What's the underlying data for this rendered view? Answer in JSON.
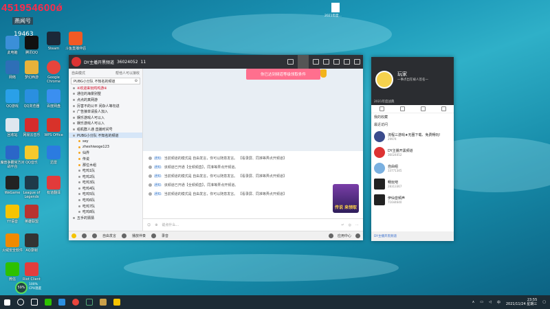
{
  "overlay": {
    "number": "451954600ǿ",
    "sub": "燕闻号",
    "num2": "19463"
  },
  "desktop": {
    "col1": [
      "此电脑",
      "网络",
      "QQ游戏",
      "回收站",
      "魔兽争霸官方对战平台",
      "WeGame",
      "YY语音",
      "火绒安全软件",
      "微信",
      "59%"
    ],
    "col2": [
      "腾讯QQ",
      "梦幻西游",
      "QQ浏览器",
      "网易云音乐",
      "QQ音乐",
      "League of Legends",
      "英雄联盟",
      "AQ录制",
      "Riot Client"
    ],
    "col3": [
      "Steam",
      "Google Chrome",
      "百度网盘",
      "WPS Office",
      "迅雷",
      "有道翻译",
      "Launcher"
    ],
    "col4": [
      "斗鱼直播伴侣"
    ],
    "file_label": "2021年度..."
  },
  "main_window": {
    "title": "DY主播开黑频道",
    "id": "36024052",
    "online": "11",
    "left_header": "自由模式",
    "left_header_right": "帮他人可以接收",
    "search_text": "PUBG小分队 不知名的频道",
    "channels": [
      "※欢迎来玩鸣鸡游※",
      "通往的海景别墅",
      "点点的真网游",
      "厉害不的公平 闲杂人等勿进",
      "广告接单请投人加入",
      "娱乐游戏人可以入",
      "娱乐游戏人可以入",
      "组机群人通 直播时间号"
    ],
    "selected_channel": "PUBG小分队 不知名的频道",
    "users": [
      "sey",
      "zheshiwoge123",
      "仙界",
      "传说",
      "那位木组"
    ],
    "sub_channels": [
      "吃鸡1队",
      "吃鸡2队",
      "吃鸡3队",
      "吃鸡4队",
      "吃鸡5队",
      "吃鸡6队",
      "吃鸡7队",
      "吃鸡8队"
    ],
    "footer_channel": "五手的猜猜",
    "banner": "你已达到频道等级领取条件",
    "messages": [
      {
        "label": "通知:",
        "text": "当前频道的模式是 自由发言，你可以随意发言。 【看录屏、同准等弄点开频道】"
      },
      {
        "label": "通知:",
        "text": "该频道已开通【全频频直】，同准等弄点开频道。"
      },
      {
        "label": "通知:",
        "text": "当前频道的模式是 自由发言，你可以随意发言。 【看录屏、同准等弄点开频道】"
      },
      {
        "label": "通知:",
        "text": "该频道已开通【全频频直】，同准等弄点开频道。"
      },
      {
        "label": "通知:",
        "text": "当前频道的模式是 自由发言，你可以随意发言。 【看录屏、同准等弄点开频道】"
      }
    ],
    "promo": "传说 来领取",
    "input_placeholder": "说点什么...",
    "bottom": {
      "mode": "自由发言",
      "play": "播放伴奏",
      "record": "录音",
      "app_center": "应用中心"
    }
  },
  "right_panel": {
    "name": "玩家",
    "signature": "一事点出在被人签名一",
    "year": "2021年度战典",
    "section_title": "我的收藏",
    "sub_section": "最近访问",
    "items": [
      {
        "name": "流程三游戏★无圈下载、免费畅玩!",
        "sub": "29974"
      },
      {
        "name": "DY主播开黑频道",
        "sub": "36024052"
      },
      {
        "name": "自由组",
        "sub": "33771345"
      },
      {
        "name": "畅玩吧",
        "sub": "28313367"
      },
      {
        "name": "伊仙音频声",
        "sub": "71644640"
      }
    ],
    "footer": "DY主播开黑频道"
  },
  "taskbar": {
    "cpu": "100%",
    "cpu_label": "CPU温度",
    "time": "23:55",
    "date": "2021/11/24 星期三",
    "lang": "中"
  }
}
